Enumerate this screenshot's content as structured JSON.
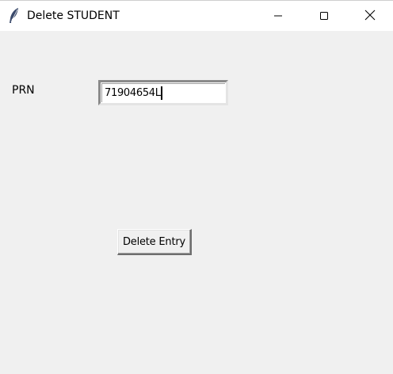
{
  "window": {
    "title": "Delete STUDENT",
    "icon": "feather-icon",
    "controls": {
      "minimize": "minimize-icon",
      "maximize": "maximize-icon",
      "close": "close-icon"
    }
  },
  "form": {
    "prn_label": "PRN",
    "prn_value": "71904654L",
    "delete_button_label": "Delete Entry"
  }
}
